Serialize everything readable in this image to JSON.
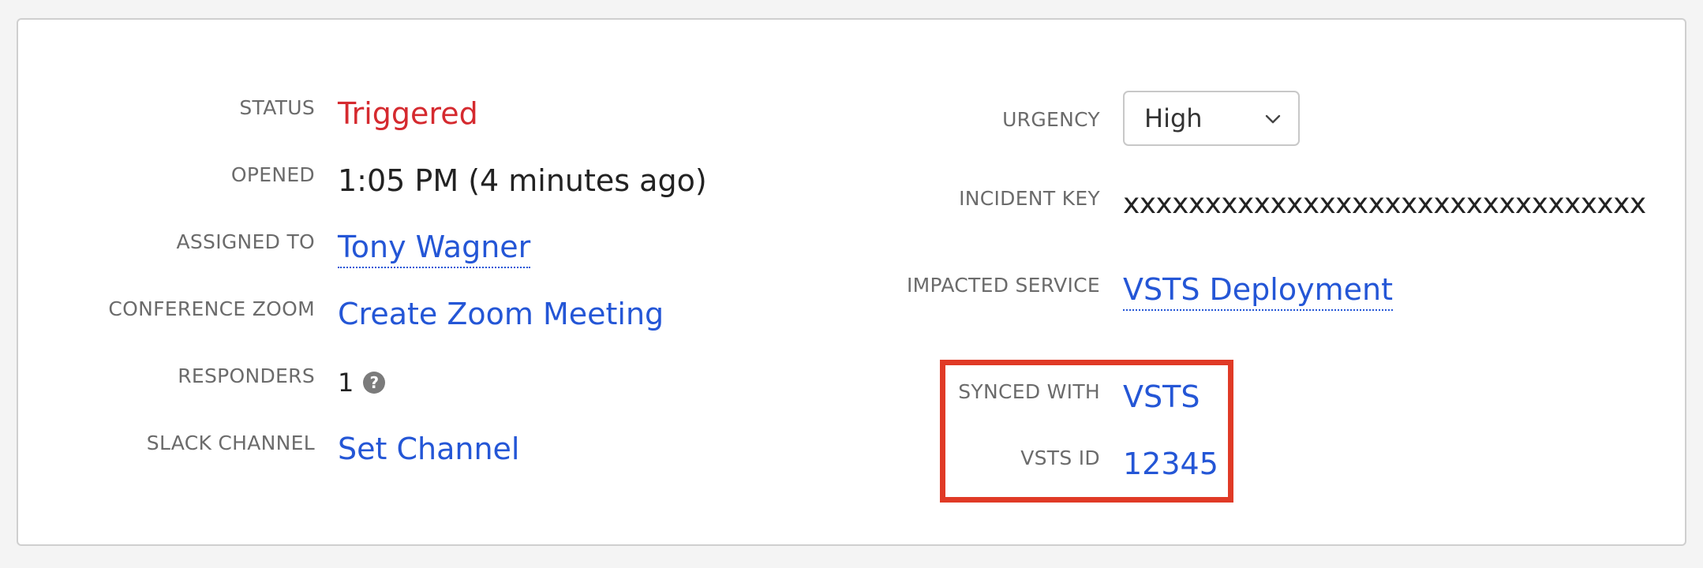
{
  "left": {
    "status": {
      "label": "STATUS",
      "value": "Triggered"
    },
    "opened": {
      "label": "OPENED",
      "value": "1:05 PM (4 minutes ago)"
    },
    "assigned_to": {
      "label": "ASSIGNED TO",
      "value": "Tony Wagner"
    },
    "conference": {
      "label": "CONFERENCE ZOOM",
      "value": "Create Zoom Meeting"
    },
    "responders": {
      "label": "RESPONDERS",
      "value": "1",
      "icon": "help-icon"
    },
    "slack": {
      "label": "SLACK CHANNEL",
      "value": "Set Channel"
    }
  },
  "right": {
    "urgency": {
      "label": "URGENCY",
      "value": "High",
      "icon": "chevron-down-icon"
    },
    "incident_key": {
      "label": "INCIDENT KEY",
      "value": "xxxxxxxxxxxxxxxxxxxxxxxxxxxxxxxx"
    },
    "impacted_service": {
      "label": "IMPACTED SERVICE",
      "value": "VSTS Deployment"
    },
    "synced_with": {
      "label": "SYNCED WITH",
      "value": "VSTS"
    },
    "vsts_id": {
      "label": "VSTS ID",
      "value": "12345"
    }
  },
  "colors": {
    "status_red": "#d52a2f",
    "link_blue": "#2456d6",
    "highlight_border": "#e03a26",
    "label_gray": "#6b6b6b"
  }
}
